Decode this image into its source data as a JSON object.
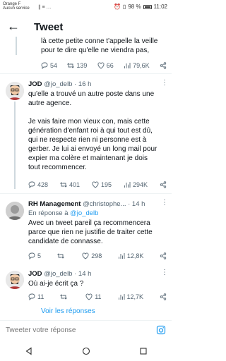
{
  "status_bar": {
    "carrier_line1": "Orange F",
    "carrier_line2": "Aucun service",
    "signal_icons": "∥ ≡ …",
    "battery_percent": "98 %",
    "time": "11:02"
  },
  "header": {
    "title": "Tweet"
  },
  "continued_tweet": {
    "text": "là cette petite conne t'appelle la veille pour te dire qu'elle ne viendra pas,",
    "replies": "54",
    "retweets": "139",
    "likes": "66",
    "views": "79,6K"
  },
  "tweet1": {
    "name": "JOD",
    "handle": "@jo_delb",
    "time": "· 16 h",
    "text_p1": "qu'elle a trouvé un autre poste dans une autre agence.",
    "text_p2": "Je vais faire mon vieux con, mais cette génération d'enfant roi à qui tout est dû, qui ne respecte rien ni personne est à gerber. Je lui ai envoyé un long mail pour expier ma colère et maintenant je dois tout recommencer.",
    "replies": "428",
    "retweets": "401",
    "likes": "195",
    "views": "294K"
  },
  "tweet2": {
    "name": "RH Management",
    "handle": "@christophe...",
    "time": "· 14 h",
    "reply_prefix": "En réponse à",
    "reply_to": "@jo_delb",
    "text": "Avec un tweet pareil ça recommencera parce que rien ne justifie de traiter cette candidate de connasse.",
    "replies": "5",
    "retweets": "",
    "likes": "298",
    "views": "12,8K"
  },
  "tweet3": {
    "name": "JOD",
    "handle": "@jo_delb",
    "time": "· 14 h",
    "text": "Où ai-je écrit ça ?",
    "replies": "11",
    "retweets": "",
    "likes": "11",
    "views": "12,7K"
  },
  "see_replies": "Voir les réponses",
  "compose": {
    "placeholder": "Tweeter votre réponse"
  },
  "colors": {
    "accent": "#1d9bf0",
    "muted": "#536471"
  }
}
